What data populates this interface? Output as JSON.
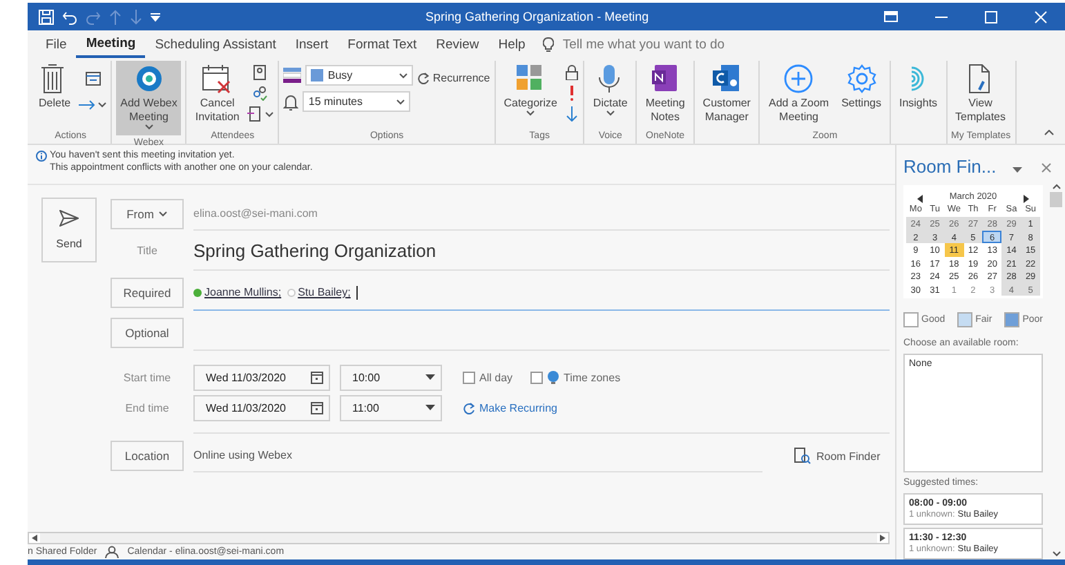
{
  "window": {
    "title": "Spring Gathering Organization  -  Meeting"
  },
  "tabs": [
    {
      "label": "File",
      "selected": false
    },
    {
      "label": "Meeting",
      "selected": true
    },
    {
      "label": "Scheduling Assistant",
      "selected": false
    },
    {
      "label": "Insert",
      "selected": false
    },
    {
      "label": "Format Text",
      "selected": false
    },
    {
      "label": "Review",
      "selected": false
    },
    {
      "label": "Help",
      "selected": false
    }
  ],
  "tell_me": {
    "placeholder": "Tell me what you want to do"
  },
  "ribbon": {
    "groups": [
      {
        "kind": "actions",
        "label": "Actions",
        "items": [
          {
            "label": "Delete",
            "dropdown": false,
            "pressed": false
          }
        ]
      },
      {
        "kind": "buttons",
        "label": "Webex",
        "items": [
          {
            "label": "Add Webex\nMeeting",
            "dropdown": true,
            "pressed": true
          }
        ]
      },
      {
        "kind": "attendees",
        "label": "Attendees",
        "items": [
          {
            "label": "Cancel\nInvitation",
            "dropdown": false,
            "pressed": false
          }
        ]
      },
      {
        "kind": "options",
        "label": "Options",
        "show_as": "Busy",
        "reminder": "15 minutes",
        "recurrence": "Recurrence"
      },
      {
        "kind": "tags",
        "label": "Tags",
        "items": [
          {
            "label": "Categorize",
            "dropdown": true,
            "pressed": false
          }
        ]
      },
      {
        "kind": "buttons",
        "label": "Voice",
        "items": [
          {
            "label": "Dictate",
            "dropdown": true,
            "pressed": false
          }
        ]
      },
      {
        "kind": "buttons",
        "label": "OneNote",
        "items": [
          {
            "label": "Meeting\nNotes",
            "dropdown": false,
            "pressed": false
          }
        ]
      },
      {
        "kind": "buttons",
        "items": [
          {
            "label": "Customer\nManager",
            "dropdown": false,
            "pressed": false
          }
        ]
      },
      {
        "kind": "buttons",
        "label": "Zoom",
        "items": [
          {
            "label": "Add a Zoom\nMeeting",
            "dropdown": false,
            "pressed": false
          },
          {
            "label": "Settings",
            "dropdown": false,
            "pressed": false
          }
        ]
      },
      {
        "kind": "buttons",
        "items": [
          {
            "label": "Insights",
            "dropdown": false,
            "pressed": false
          }
        ]
      },
      {
        "kind": "buttons",
        "label": "My Templates",
        "items": [
          {
            "label": "View\nTemplates",
            "dropdown": false,
            "pressed": false
          }
        ]
      }
    ]
  },
  "infobar": [
    "You haven't sent this meeting invitation yet.",
    "This appointment conflicts with another one on your calendar."
  ],
  "form": {
    "send": "Send",
    "from_button": "From",
    "from": "elina.oost@sei-mani.com",
    "title_label": "Title",
    "title": "Spring Gathering Organization",
    "required_button": "Required",
    "required": [
      {
        "name": "Joanne Mullins;",
        "available": true
      },
      {
        "name": "Stu Bailey;",
        "available": false
      }
    ],
    "optional_button": "Optional",
    "start_label": "Start time",
    "start_date": "Wed 11/03/2020",
    "start_time": "10:00",
    "end_label": "End time",
    "end_date": "Wed 11/03/2020",
    "end_time": "11:00",
    "all_day": {
      "label": "All day",
      "checked": false
    },
    "time_zones": {
      "label": "Time zones",
      "checked": false
    },
    "make_recurring": "Make Recurring",
    "location_button": "Location",
    "location": "Online using Webex",
    "room_finder": "Room Finder"
  },
  "room_finder": {
    "title": "Room Fin...",
    "month": "March 2020",
    "weekdays": [
      "Mo",
      "Tu",
      "We",
      "Th",
      "Fr",
      "Sa",
      "Su"
    ],
    "days": [
      {
        "d": "24",
        "other": true,
        "shaded": true,
        "selected": false,
        "today": false
      },
      {
        "d": "25",
        "other": true,
        "shaded": true,
        "selected": false,
        "today": false
      },
      {
        "d": "26",
        "other": true,
        "shaded": true,
        "selected": false,
        "today": false
      },
      {
        "d": "27",
        "other": true,
        "shaded": true,
        "selected": false,
        "today": false
      },
      {
        "d": "28",
        "other": true,
        "shaded": true,
        "selected": false,
        "today": false
      },
      {
        "d": "29",
        "other": true,
        "shaded": true,
        "selected": false,
        "today": false
      },
      {
        "d": "1",
        "other": false,
        "shaded": true,
        "selected": false,
        "today": false
      },
      {
        "d": "2",
        "other": false,
        "shaded": true,
        "selected": false,
        "today": false
      },
      {
        "d": "3",
        "other": false,
        "shaded": true,
        "selected": false,
        "today": false
      },
      {
        "d": "4",
        "other": false,
        "shaded": true,
        "selected": false,
        "today": false
      },
      {
        "d": "5",
        "other": false,
        "shaded": true,
        "selected": false,
        "today": false
      },
      {
        "d": "6",
        "other": false,
        "shaded": true,
        "selected": true,
        "today": false
      },
      {
        "d": "7",
        "other": false,
        "shaded": true,
        "selected": false,
        "today": false
      },
      {
        "d": "8",
        "other": false,
        "shaded": true,
        "selected": false,
        "today": false
      },
      {
        "d": "9",
        "other": false,
        "shaded": false,
        "selected": false,
        "today": false
      },
      {
        "d": "10",
        "other": false,
        "shaded": false,
        "selected": false,
        "today": false
      },
      {
        "d": "11",
        "other": false,
        "shaded": false,
        "selected": false,
        "today": true
      },
      {
        "d": "12",
        "other": false,
        "shaded": false,
        "selected": false,
        "today": false
      },
      {
        "d": "13",
        "other": false,
        "shaded": false,
        "selected": false,
        "today": false
      },
      {
        "d": "14",
        "other": false,
        "shaded": true,
        "selected": false,
        "today": false
      },
      {
        "d": "15",
        "other": false,
        "shaded": true,
        "selected": false,
        "today": false
      },
      {
        "d": "16",
        "other": false,
        "shaded": false,
        "selected": false,
        "today": false
      },
      {
        "d": "17",
        "other": false,
        "shaded": false,
        "selected": false,
        "today": false
      },
      {
        "d": "18",
        "other": false,
        "shaded": false,
        "selected": false,
        "today": false
      },
      {
        "d": "19",
        "other": false,
        "shaded": false,
        "selected": false,
        "today": false
      },
      {
        "d": "20",
        "other": false,
        "shaded": false,
        "selected": false,
        "today": false
      },
      {
        "d": "21",
        "other": false,
        "shaded": true,
        "selected": false,
        "today": false
      },
      {
        "d": "22",
        "other": false,
        "shaded": true,
        "selected": false,
        "today": false
      },
      {
        "d": "23",
        "other": false,
        "shaded": false,
        "selected": false,
        "today": false
      },
      {
        "d": "24",
        "other": false,
        "shaded": false,
        "selected": false,
        "today": false
      },
      {
        "d": "25",
        "other": false,
        "shaded": false,
        "selected": false,
        "today": false
      },
      {
        "d": "26",
        "other": false,
        "shaded": false,
        "selected": false,
        "today": false
      },
      {
        "d": "27",
        "other": false,
        "shaded": false,
        "selected": false,
        "today": false
      },
      {
        "d": "28",
        "other": false,
        "shaded": true,
        "selected": false,
        "today": false
      },
      {
        "d": "29",
        "other": false,
        "shaded": true,
        "selected": false,
        "today": false
      },
      {
        "d": "30",
        "other": false,
        "shaded": false,
        "selected": false,
        "today": false
      },
      {
        "d": "31",
        "other": false,
        "shaded": false,
        "selected": false,
        "today": false
      },
      {
        "d": "1",
        "other": true,
        "shaded": false,
        "selected": false,
        "today": false
      },
      {
        "d": "2",
        "other": true,
        "shaded": false,
        "selected": false,
        "today": false
      },
      {
        "d": "3",
        "other": true,
        "shaded": false,
        "selected": false,
        "today": false
      },
      {
        "d": "4",
        "other": true,
        "shaded": true,
        "selected": false,
        "today": false
      },
      {
        "d": "5",
        "other": true,
        "shaded": true,
        "selected": false,
        "today": false
      }
    ],
    "legend": [
      {
        "label": "Good",
        "color": "#ffffff"
      },
      {
        "label": "Fair",
        "color": "#c5dcf2"
      },
      {
        "label": "Poor",
        "color": "#6f9fd8"
      }
    ],
    "rooms_label": "Choose an available room:",
    "rooms": [
      "None"
    ],
    "suggested_label": "Suggested times:",
    "suggestions": [
      {
        "time": "08:00 - 09:00",
        "status": "1 unknown:",
        "names": "Stu Bailey"
      },
      {
        "time": "11:30 - 12:30",
        "status": "1 unknown:",
        "names": "Stu Bailey"
      }
    ]
  },
  "status_bar": {
    "folder": "n Shared Folder",
    "calendar": "Calendar - elina.oost@sei-mani.com"
  }
}
